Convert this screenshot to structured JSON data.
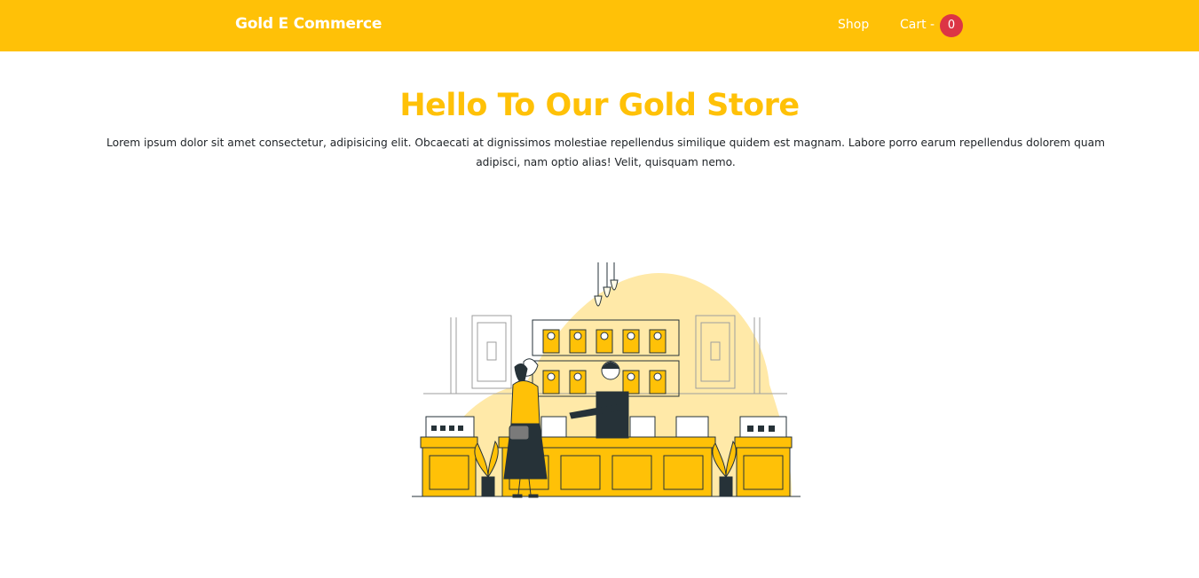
{
  "navbar": {
    "brand": "Gold E Commerce",
    "links": [
      {
        "label": "Shop"
      },
      {
        "label": "Cart -"
      }
    ],
    "cart_count": "0"
  },
  "hero": {
    "title": "Hello To Our Gold Store",
    "text": "Lorem ipsum dolor sit amet consectetur, adipisicing elit. Obcaecati at dignissimos molestiae repellendus similique quidem est magnam. Labore porro earum repellendus dolorem quam adipisci, nam optio alias! Velit, quisquam nemo."
  },
  "colors": {
    "primary": "#ffc107",
    "badge": "#dc3545",
    "text": "#212529",
    "blob": "#ffe9a8",
    "ink": "#263238"
  },
  "illustration": {
    "subject": "jewelry-store-illustration"
  }
}
